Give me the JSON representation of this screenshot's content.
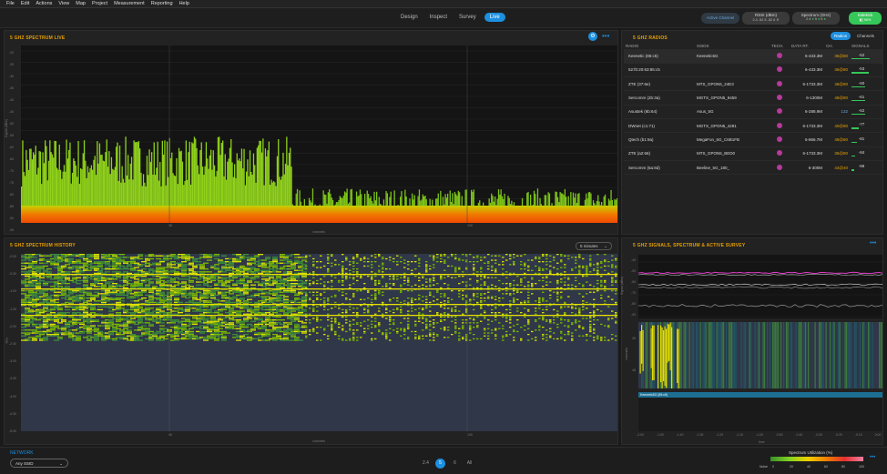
{
  "menu": [
    "File",
    "Edit",
    "Actions",
    "View",
    "Map",
    "Project",
    "Measurement",
    "Reporting",
    "Help"
  ],
  "modes": [
    "Design",
    "Inspect",
    "Survey",
    "Live"
  ],
  "active_mode": "Live",
  "toolbar": {
    "active_channel": "Active Channel",
    "rssi_label": "RSSI (dBm)",
    "rssi_24": "2.4 -52",
    "rssi_5": "5 -52",
    "rssi_6": "6",
    "spectrum_label": "Spectrum (GHz)",
    "spectrum_24": "2.4",
    "spectrum_5": "5",
    "spectrum_6": "6",
    "sidekick": "Sidekick",
    "sidekick_pct": "90%"
  },
  "spectrum_live": {
    "title": "5 GHZ SPECTRUM LIVE",
    "ylabel": "Signal (dBm)",
    "xlabel": "channels",
    "yticks": [
      "-20",
      "-25",
      "-30",
      "-35",
      "-40",
      "-45",
      "-50",
      "-55",
      "-60",
      "-65",
      "-70",
      "-75",
      "-80",
      "-85",
      "-90",
      "-95"
    ],
    "xticks": [
      "36",
      "100"
    ]
  },
  "radios": {
    "title": "5 GHZ RADIOS",
    "tabs": [
      "Radios",
      "Channels"
    ],
    "columns": [
      "RADIO",
      "SSIDS",
      "TECH.",
      "DATA RT.",
      "CH.",
      "SIGNALS"
    ],
    "rows": [
      {
        "radio": "Keenetic (85:c5)",
        "ssid": "Keenetic5G",
        "rate": "6-433.3M",
        "ch": "36@80",
        "sig": "-52",
        "w": 0.9
      },
      {
        "radio": "52:f0:20:63:85:c5",
        "ssid": "",
        "rate": "6-433.3M",
        "ch": "36@80",
        "sig": "-53",
        "w": 0.88
      },
      {
        "radio": "ZTE (37:6e)",
        "ssid": "MTS_GPON5_24E3",
        "rate": "6-1733.3M",
        "ch": "48@80",
        "sig": "-60",
        "w": 0.7
      },
      {
        "radio": "Sercomm (2b:3a)",
        "ssid": "MGTS_GPON5_9459",
        "rate": "6-1300M",
        "ch": "48@80",
        "sig": "-61",
        "w": 0.68
      },
      {
        "radio": "Asustek (6b:64)",
        "ssid": "Asus_5G",
        "rate": "6-288.9M",
        "ch": "132",
        "sig": "-62",
        "w": 0.66
      },
      {
        "radio": "DWnet (c1:71)",
        "ssid": "MGTS_GPON5_4281",
        "rate": "6-1733.3M",
        "ch": "40@80",
        "sig": "-77",
        "w": 0.35
      },
      {
        "radio": "Qtech (b1:9a)",
        "ssid": "MegaFon_5G_C6B1FB",
        "rate": "6-866.7M",
        "ch": "48@80",
        "sig": "-81",
        "w": 0.28
      },
      {
        "radio": "ZTE (a2:66)",
        "ssid": "MTS_GPON5_BED0",
        "rate": "6-1733.3M",
        "ch": "36@80",
        "sig": "-84",
        "w": 0.2
      },
      {
        "radio": "Sercomm (5a:8d)",
        "ssid": "Beeline_5G_180_",
        "rate": "6-300M",
        "ch": "44@40",
        "sig": "-86",
        "w": 0.15
      }
    ]
  },
  "history": {
    "title": "5 GHZ SPECTRUM HISTORY",
    "range": "5 minutes",
    "ylabel": "time",
    "xlabel": "channels",
    "yticks": [
      "-0:00",
      "-0:30",
      "-1:00",
      "-1:30",
      "-2:00",
      "-2:30",
      "-3:00",
      "-3:30",
      "-4:00",
      "-4:30",
      "-5:00"
    ],
    "xticks": [
      "36",
      "100"
    ]
  },
  "signals": {
    "title": "5 GHZ SIGNALS, SPECTRUM & ACTIVE SURVEY",
    "ylabel_top": "Signal (dBm)",
    "ylabel_mid": "channels",
    "yticks_top": [
      "-40",
      "-50",
      "-60",
      "-70",
      "-80",
      "-90"
    ],
    "yticks_mid": [
      "36",
      "48"
    ],
    "bar_label": "Keenetic5G (85:c5)",
    "xlabel": "time",
    "xticks": [
      "-2:00",
      "-1:50",
      "-1:40",
      "-1:30",
      "-1:20",
      "-1:10",
      "-1:00",
      "-0:50",
      "-0:40",
      "-0:30",
      "-0:20",
      "-0:10",
      "0:00"
    ]
  },
  "bottom": {
    "network_label": "NETWORK",
    "ssid_select": "Any SSID",
    "bands": [
      "2.4",
      "5",
      "6",
      "All"
    ],
    "active_band": "5",
    "util_label": "Spectrum Utilization (%)",
    "util_ticks": [
      "Noise",
      "0",
      "20",
      "40",
      "60",
      "80",
      "100"
    ]
  },
  "colors": {
    "accent": "#1d8fe0",
    "title": "#e8a000",
    "green": "#35c759",
    "magenta": "#e03cc8"
  }
}
